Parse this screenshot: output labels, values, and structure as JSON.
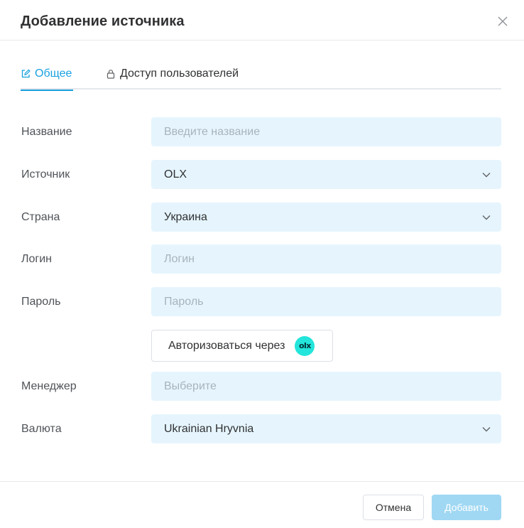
{
  "dialog": {
    "title": "Добавление источника",
    "close_icon": "close-icon"
  },
  "tabs": [
    {
      "label": "Общее",
      "icon": "edit-icon",
      "active": true
    },
    {
      "label": "Доступ пользователей",
      "icon": "lock-icon",
      "active": false
    }
  ],
  "form": {
    "name": {
      "label": "Название",
      "placeholder": "Введите название",
      "value": ""
    },
    "source": {
      "label": "Источник",
      "value": "OLX"
    },
    "country": {
      "label": "Страна",
      "value": "Украина"
    },
    "login": {
      "label": "Логин",
      "placeholder": "Логин",
      "value": ""
    },
    "password": {
      "label": "Пароль",
      "placeholder": "Пароль",
      "value": ""
    },
    "authorize": {
      "label": "Авторизоваться через",
      "logo_text": "olx"
    },
    "manager": {
      "label": "Менеджер",
      "placeholder": "Выберите",
      "value": ""
    },
    "currency": {
      "label": "Валюта",
      "value": "Ukrainian Hryvnia"
    }
  },
  "footer": {
    "cancel_label": "Отмена",
    "add_label": "Добавить"
  },
  "colors": {
    "accent": "#1aa1e0",
    "field_bg": "#e6f5fd",
    "add_button_disabled": "#a0d8f3",
    "olx_brand": "#23e5db"
  }
}
